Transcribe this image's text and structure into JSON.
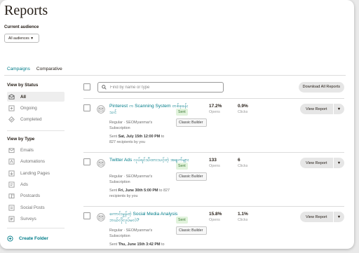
{
  "page": {
    "title": "Reports"
  },
  "audience": {
    "label": "Current audience",
    "selected": "All audiences",
    "chevron": "chevron-down-icon"
  },
  "tabs": [
    {
      "label": "Campaigns",
      "active": true
    },
    {
      "label": "Comparative",
      "active": false
    }
  ],
  "sidebar": {
    "status_heading": "View by Status",
    "status_items": [
      {
        "label": "All",
        "icon": "all-campaigns-icon",
        "active": true
      },
      {
        "label": "Ongoing",
        "icon": "ongoing-icon",
        "active": false
      },
      {
        "label": "Completed",
        "icon": "completed-icon",
        "active": false
      }
    ],
    "type_heading": "View by Type",
    "type_items": [
      {
        "label": "Emails",
        "icon": "email-icon"
      },
      {
        "label": "Automations",
        "icon": "automation-icon"
      },
      {
        "label": "Landing Pages",
        "icon": "landing-page-icon"
      },
      {
        "label": "Ads",
        "icon": "ads-icon"
      },
      {
        "label": "Postcards",
        "icon": "postcard-icon"
      },
      {
        "label": "Social Posts",
        "icon": "social-post-icon"
      },
      {
        "label": "Surveys",
        "icon": "survey-icon"
      }
    ],
    "create_folder": "Create Folder"
  },
  "toolbar": {
    "search_placeholder": "Find by name or type",
    "download_label": "Download All Reports"
  },
  "campaigns": [
    {
      "name": "Pinterest က Scanning System တစ်ခုခန်းသင်",
      "type_line": "Regular · SEOMyanmar's",
      "list_line": "Subscription",
      "sent_prefix": "Sent",
      "sent_date": "Sat, July 15th 12:00 PM",
      "sent_suffix": "to",
      "recipients": "827 recipients by you",
      "status": "Sent",
      "builder": "Classic Builder",
      "opens_value": "17.2%",
      "opens_label": "Opens",
      "clicks_value": "0.9%",
      "clicks_label": "Clicks",
      "action": "View Report"
    },
    {
      "name": "Twitter Ads လုပ်ရင်သိထားသင့်တဲ့ အချက်များ",
      "type_line": "Regular · SEOMyanmar's",
      "list_line": "Subscription",
      "sent_prefix": "Sent",
      "sent_date": "Fri, June 30th 5:00 PM",
      "sent_suffix": "to 827",
      "recipients": "recipients by you",
      "status": "Sent",
      "builder": "Classic Builder",
      "opens_value": "133",
      "opens_label": "Opens",
      "clicks_value": "6",
      "clicks_label": "Clicks",
      "action": "View Report"
    },
    {
      "name": "ကောင်းမွန်တဲ့ Social Media Analysis ဘယ်လိုလုပ်မလဲ?",
      "type_line": "Regular · SEOMyanmar's",
      "list_line": "Subscription",
      "sent_prefix": "Sent",
      "sent_date": "Thu, June 15th 3:42 PM",
      "sent_suffix": "to",
      "recipients": "",
      "status": "Sent",
      "builder": "Classic Builder",
      "opens_value": "15.8%",
      "opens_label": "Opens",
      "clicks_value": "1.1%",
      "clicks_label": "Clicks",
      "action": "View Report"
    }
  ],
  "colors": {
    "accent": "#007c89",
    "sent_badge": "#e1f3dc",
    "button_bg": "#e6e6e6"
  }
}
